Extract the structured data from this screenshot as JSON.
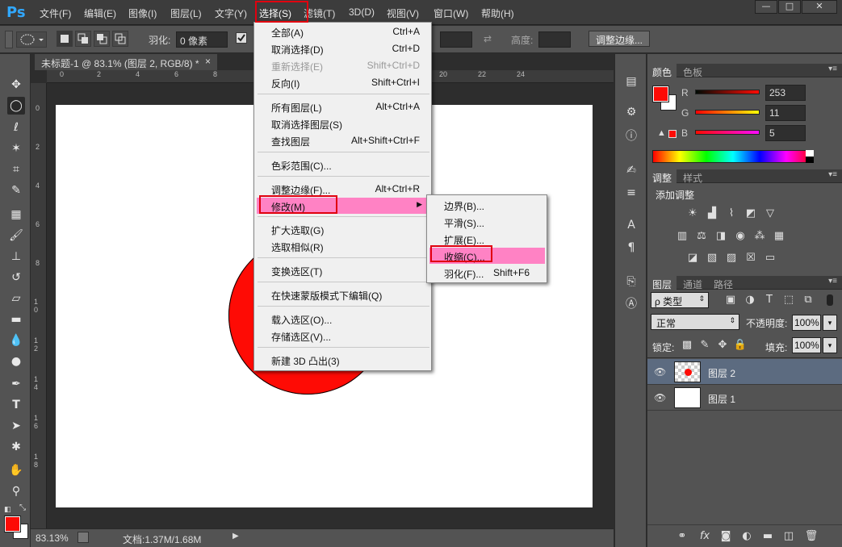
{
  "app": {
    "logo": "Ps"
  },
  "menubar": {
    "items": [
      "文件(F)",
      "编辑(E)",
      "图像(I)",
      "图层(L)",
      "文字(Y)",
      "选择(S)",
      "滤镜(T)",
      "3D(D)",
      "视图(V)",
      "窗口(W)",
      "帮助(H)"
    ]
  },
  "window_controls": [
    "—",
    "□",
    "✕"
  ],
  "options": {
    "feather_label": "羽化:",
    "feather_value": "0 像素",
    "height_label": "高度:",
    "refine_edge_button": "调整边缘..."
  },
  "document": {
    "tab_title": "未标题-1 @ 83.1% (图层 2, RGB/8) *",
    "tab_close": "×",
    "ruler_top": [
      "0",
      "2",
      "4",
      "6",
      "8",
      "20",
      "22",
      "24"
    ],
    "ruler_left": [
      "0",
      "2",
      "4",
      "6",
      "8",
      "1 0",
      "1 2",
      "1 4",
      "1 6",
      "1 8"
    ],
    "circle_color": "#fe0b05"
  },
  "status": {
    "zoom": "83.13%",
    "doc_info": "文档:1.37M/1.68M"
  },
  "select_menu": {
    "items": [
      {
        "label": "全部(A)",
        "shortcut": "Ctrl+A"
      },
      {
        "label": "取消选择(D)",
        "shortcut": "Ctrl+D"
      },
      {
        "label": "重新选择(E)",
        "shortcut": "Shift+Ctrl+D"
      },
      {
        "label": "反向(I)",
        "shortcut": "Shift+Ctrl+I"
      },
      {
        "label": "所有图层(L)",
        "shortcut": "Alt+Ctrl+A"
      },
      {
        "label": "取消选择图层(S)",
        "shortcut": ""
      },
      {
        "label": "查找图层",
        "shortcut": "Alt+Shift+Ctrl+F"
      },
      {
        "label": "色彩范围(C)...",
        "shortcut": ""
      },
      {
        "label": "调整边缘(F)...",
        "shortcut": "Alt+Ctrl+R"
      },
      {
        "label": "修改(M)",
        "shortcut": ""
      },
      {
        "label": "扩大选取(G)",
        "shortcut": ""
      },
      {
        "label": "选取相似(R)",
        "shortcut": ""
      },
      {
        "label": "变换选区(T)",
        "shortcut": ""
      },
      {
        "label": "在快速蒙版模式下编辑(Q)",
        "shortcut": ""
      },
      {
        "label": "载入选区(O)...",
        "shortcut": ""
      },
      {
        "label": "存储选区(V)...",
        "shortcut": ""
      },
      {
        "label": "新建 3D 凸出(3)",
        "shortcut": ""
      }
    ],
    "submenu_arrow": "▶"
  },
  "modify_submenu": {
    "items": [
      {
        "label": "边界(B)...",
        "shortcut": ""
      },
      {
        "label": "平滑(S)...",
        "shortcut": ""
      },
      {
        "label": "扩展(E)...",
        "shortcut": ""
      },
      {
        "label": "收缩(C)...",
        "shortcut": ""
      },
      {
        "label": "羽化(F)...",
        "shortcut": "Shift+F6"
      }
    ]
  },
  "color_panel": {
    "tabs": [
      "颜色",
      "色板"
    ],
    "channels": [
      {
        "name": "R",
        "value": "253"
      },
      {
        "name": "G",
        "value": "11"
      },
      {
        "name": "B",
        "value": "5"
      }
    ],
    "foreground_color": "#fd0b05"
  },
  "adjustments_panel": {
    "tabs": [
      "调整",
      "样式"
    ],
    "title": "添加调整"
  },
  "layers_panel": {
    "tabs": [
      "图层",
      "通道",
      "路径"
    ],
    "filter_label": "ρ 类型",
    "blend_mode": "正常",
    "opacity_label": "不透明度:",
    "opacity_value": "100%",
    "lock_label": "锁定:",
    "fill_label": "填充:",
    "fill_value": "100%",
    "layers": [
      {
        "name": "图层 2"
      },
      {
        "name": "图层 1"
      }
    ]
  },
  "colors": {
    "accent_pink": "#ff82c4",
    "highlight_red": "#e1000f"
  }
}
